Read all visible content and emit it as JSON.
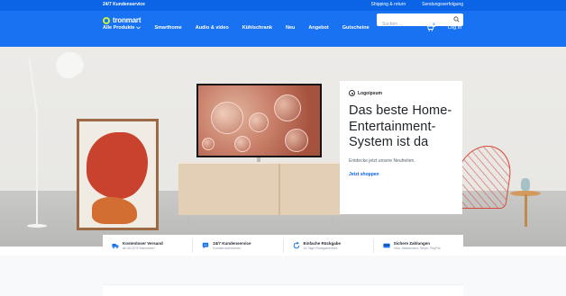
{
  "topbar": {
    "service": "24/7 Kundenservice",
    "links": [
      "Shipping & return",
      "Sendungsverfolgung"
    ]
  },
  "header": {
    "logo": "tronmart",
    "search_placeholder": "Suchen ...",
    "nav": [
      "Alle Produkte",
      "Smarthome",
      "Audio & video",
      "Kühlschrank",
      "Neu",
      "Angebot",
      "Gutscheine"
    ],
    "cart_count": "0",
    "login": "Log In"
  },
  "hero": {
    "brand": "Logoipsum",
    "title": "Das beste Home-Entertainment-System ist da",
    "subtitle": "Entdecke jetzt unsere Neuheiten.",
    "cta": "Jetzt shoppen"
  },
  "benefits": [
    {
      "icon": "truck-icon",
      "title": "Kostenloser Versand",
      "sub": "Ab 50,00 € Warenwert"
    },
    {
      "icon": "chat-icon",
      "title": "24/7 Kundenservice",
      "sub": "Kontakt aufnehmen"
    },
    {
      "icon": "return-icon",
      "title": "Einfache Rückgabe",
      "sub": "14 Tage Rückgaberecht"
    },
    {
      "icon": "card-icon",
      "title": "Sichere Zahlungen",
      "sub": "Visa, Mastercard, Stripe, PayPal"
    }
  ],
  "colors": {
    "primary": "#1972f2",
    "topbar": "#0b63e5",
    "accent": "#c7f43b"
  }
}
